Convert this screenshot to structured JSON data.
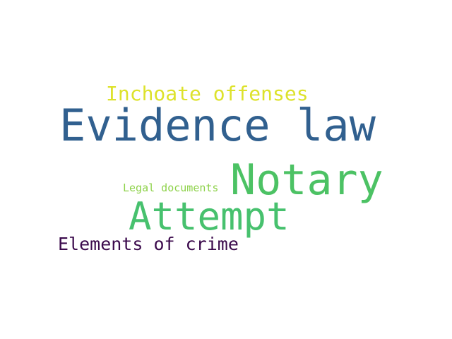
{
  "word_cloud": {
    "background": "#ffffff",
    "words": [
      {
        "text": "Evidence law",
        "color": "#31608f"
      },
      {
        "text": "Notary",
        "color": "#4cc264"
      },
      {
        "text": "Attempt",
        "color": "#47c16e"
      },
      {
        "text": "Inchoate offenses",
        "color": "#dde22b"
      },
      {
        "text": "Elements of crime",
        "color": "#3b0a4c"
      },
      {
        "text": "Legal documents",
        "color": "#8ed24a"
      }
    ]
  }
}
